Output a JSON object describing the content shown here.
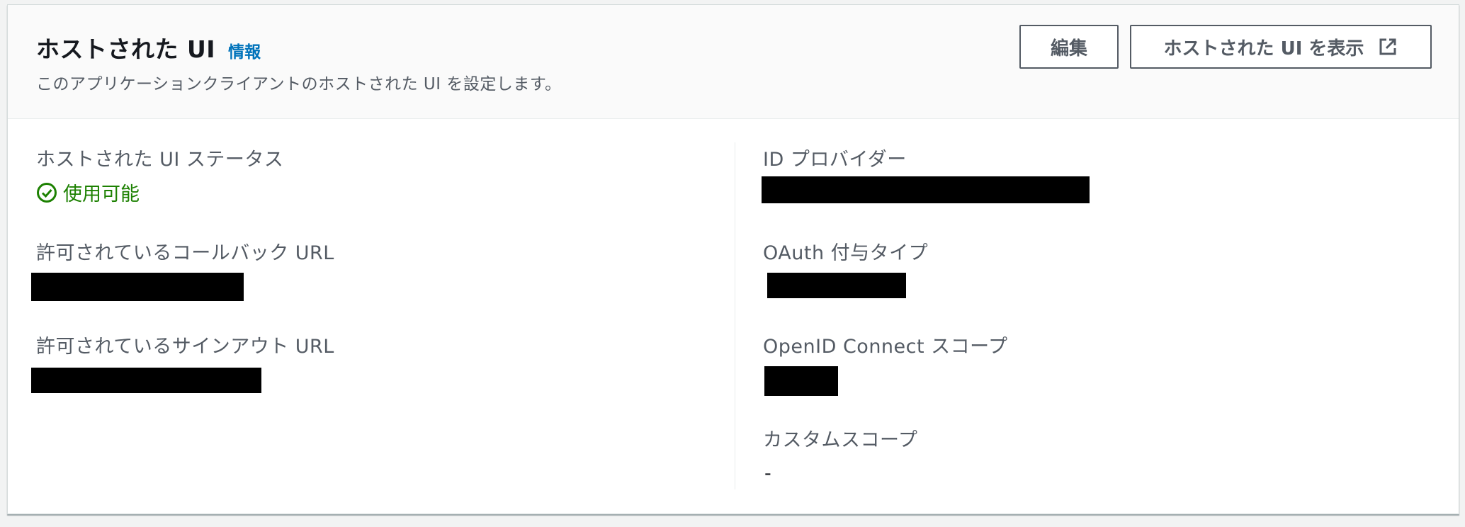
{
  "header": {
    "title": "ホストされた UI",
    "info_label": "情報",
    "description": "このアプリケーションクライアントのホストされた UI を設定します。",
    "edit_label": "編集",
    "view_label": "ホストされた UI を表示"
  },
  "left_column": {
    "status_label": "ホストされた UI ステータス",
    "status_value": "使用可能",
    "callback_label": "許可されているコールバック URL",
    "signout_label": "許可されているサインアウト URL"
  },
  "right_column": {
    "idp_label": "ID プロバイダー",
    "oauth_label": "OAuth 付与タイプ",
    "oidc_label": "OpenID Connect スコープ",
    "custom_scope_label": "カスタムスコープ",
    "custom_scope_value": "-"
  },
  "colors": {
    "accent_link": "#0073bb",
    "status_success": "#1d8102",
    "label_gray": "#545b64"
  },
  "icons": {
    "external_link": "external-link-icon",
    "status_check": "check-circle-icon"
  }
}
